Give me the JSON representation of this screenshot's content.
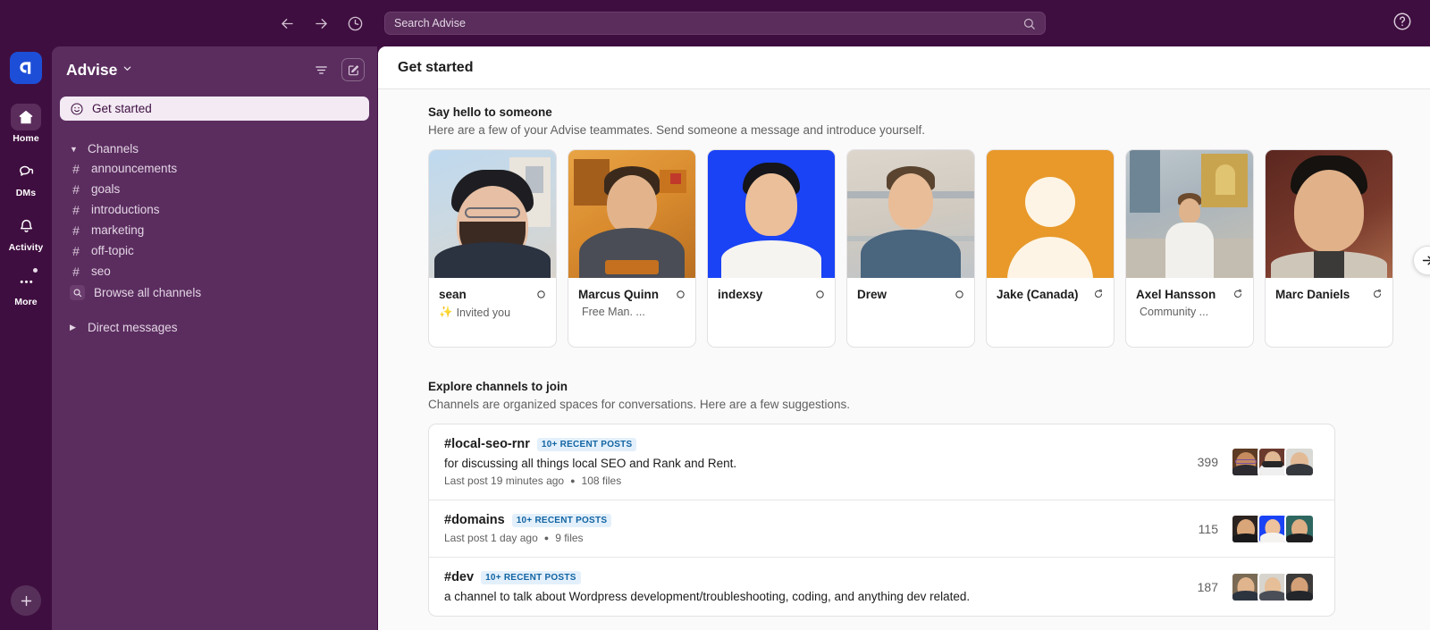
{
  "topbar": {
    "back_icon": "arrow-left-icon",
    "forward_icon": "arrow-right-icon",
    "history_icon": "clock-icon",
    "search_placeholder": "Search Advise",
    "search_value": "Search Advise",
    "search_icon": "search-icon",
    "help_icon": "help-circle-icon"
  },
  "rail": {
    "workspace_name": "Advise",
    "items": [
      {
        "label": "Home",
        "icon": "home-icon",
        "active": true,
        "dot": false
      },
      {
        "label": "DMs",
        "icon": "dms-icon",
        "active": false,
        "dot": false
      },
      {
        "label": "Activity",
        "icon": "bell-icon",
        "active": false,
        "dot": false
      },
      {
        "label": "More",
        "icon": "more-dots-icon",
        "active": false,
        "dot": true
      }
    ],
    "new_button_label": "+"
  },
  "sidebar": {
    "workspace_title": "Advise",
    "chevron": "⌄",
    "filter_icon": "filter-icon",
    "compose_icon": "compose-icon",
    "get_started": {
      "label": "Get started",
      "icon": "smiley-icon"
    },
    "channels_section": {
      "label": "Channels",
      "expanded": true,
      "items": [
        {
          "label": "announcements"
        },
        {
          "label": "goals"
        },
        {
          "label": "introductions"
        },
        {
          "label": "marketing"
        },
        {
          "label": "off-topic"
        },
        {
          "label": "seo"
        }
      ],
      "browse_all": {
        "label": "Browse all channels",
        "icon": "search-icon"
      }
    },
    "dms_section": {
      "label": "Direct messages",
      "expanded": false
    }
  },
  "main": {
    "title": "Get started",
    "say_hello": {
      "heading": "Say hello to someone",
      "subheading": "Here are a few of your Advise teammates. Send someone a message and introduce yourself.",
      "next_icon": "arrow-right-icon",
      "people": [
        {
          "name": "sean",
          "status_icon": "status-away-circle",
          "desc": "Invited you",
          "desc_emoji": "✨",
          "photo": "photo-bearded-man-cap"
        },
        {
          "name": "Marcus Quinn",
          "status_icon": "status-away-circle",
          "desc": "Free Man. ...",
          "desc_emoji": "",
          "photo": "photo-man-orange-room"
        },
        {
          "name": "indexsy",
          "status_icon": "status-away-circle",
          "desc": "",
          "desc_emoji": "",
          "photo": "photo-man-blue-bg"
        },
        {
          "name": "Drew",
          "status_icon": "status-away-circle",
          "desc": "",
          "desc_emoji": "",
          "photo": "photo-man-building"
        },
        {
          "name": "Jake (Canada)",
          "status_icon": "status-huddle-icon",
          "desc": "",
          "desc_emoji": "",
          "photo": "photo-default-orange-avatar"
        },
        {
          "name": "Axel Hansson",
          "status_icon": "status-huddle-icon",
          "desc": "Community ...",
          "desc_emoji": "",
          "photo": "photo-man-white-shirt"
        },
        {
          "name": "Marc Daniels",
          "status_icon": "status-huddle-icon",
          "desc": "",
          "desc_emoji": "",
          "photo": "photo-man-dark-red-bg"
        }
      ]
    },
    "explore_channels": {
      "heading": "Explore channels to join",
      "subheading": "Channels are organized spaces for conversations. Here are a few suggestions.",
      "rows": [
        {
          "hash": "#",
          "name": "local-seo-rnr",
          "badge": "10+ RECENT POSTS",
          "description": "for discussing all things local SEO and Rank and Rent.",
          "meta_last_post": "Last post 19 minutes ago",
          "meta_files": "108 files",
          "member_count": "399",
          "avatars": [
            "av-glasses-man",
            "av-headphones-man",
            "av-bald-man"
          ]
        },
        {
          "hash": "#",
          "name": "domains",
          "badge": "10+ RECENT POSTS",
          "description": "",
          "meta_last_post": "Last post 1 day ago",
          "meta_files": "9 files",
          "member_count": "115",
          "avatars": [
            "av-dark-smiling-man",
            "av-blue-bg-man",
            "av-teal-bg-man"
          ]
        },
        {
          "hash": "#",
          "name": "dev",
          "badge": "10+ RECENT POSTS",
          "description": "a channel to talk about Wordpress development/troubleshooting, coding, and anything dev related.",
          "meta_last_post": "",
          "meta_files": "",
          "member_count": "187",
          "avatars": [
            "av-man-a",
            "av-man-b",
            "av-man-c"
          ]
        }
      ]
    }
  },
  "colors": {
    "sidebar_bg": "#5B2D5F",
    "rail_bg": "#3F0E40",
    "accent_blue": "#1264A3",
    "badge_bg": "#E3F0FB",
    "workspace_icon_bg": "#1D4ED8",
    "main_bg": "#FBFAFB"
  }
}
